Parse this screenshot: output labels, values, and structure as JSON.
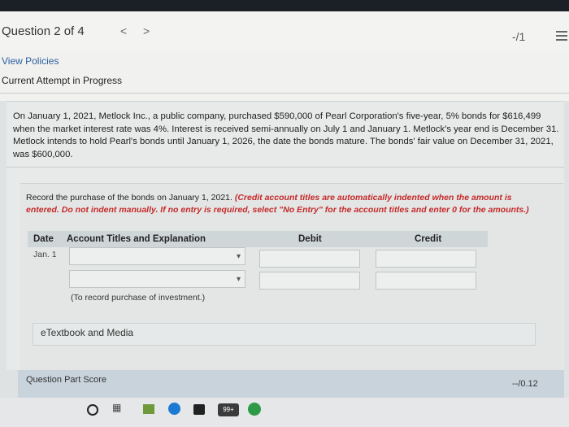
{
  "header": {
    "question_position": "Question 2 of 4",
    "prev_glyph": "<",
    "next_glyph": ">",
    "score": "-/1"
  },
  "links": {
    "view_policies": "View Policies",
    "attempt_status": "Current Attempt in Progress"
  },
  "problem_text": "On January 1, 2021, Metlock Inc., a public company, purchased $590,000 of Pearl Corporation's five-year, 5% bonds for $616,499 when the market interest rate was 4%. Interest is received semi-annually on July 1 and January 1. Metlock's year end is December 31. Metlock intends to hold Pearl's bonds until January 1, 2026, the date the bonds mature. The bonds' fair value on December 31, 2021, was $600,000.",
  "instruction": {
    "plain": "Record the purchase of the bonds on January 1, 2021. ",
    "emphasis": "(Credit account titles are automatically indented when the amount is entered. Do not indent manually. If no entry is required, select \"No Entry\" for the account titles and enter 0 for the amounts.)"
  },
  "table": {
    "headers": {
      "date": "Date",
      "account": "Account Titles and Explanation",
      "debit": "Debit",
      "credit": "Credit"
    },
    "date_value": "Jan. 1",
    "note": "(To record purchase of investment.)"
  },
  "etextbook_label": "eTextbook and Media",
  "part_score": {
    "label": "Question Part Score",
    "value": "--/0.12"
  },
  "taskbar": {
    "mail_badge": "99+"
  },
  "colors": {
    "link": "#2a5fa0",
    "instruction_emphasis": "#c62828",
    "score_bar": "#c8d3dc"
  },
  "icons": [
    "chevron-left-icon",
    "chevron-right-icon",
    "menu-icon",
    "select-chevron-icon",
    "search-icon",
    "task-view-icon",
    "store-icon",
    "edge-icon",
    "bag-icon",
    "mail-icon",
    "chrome-icon"
  ]
}
